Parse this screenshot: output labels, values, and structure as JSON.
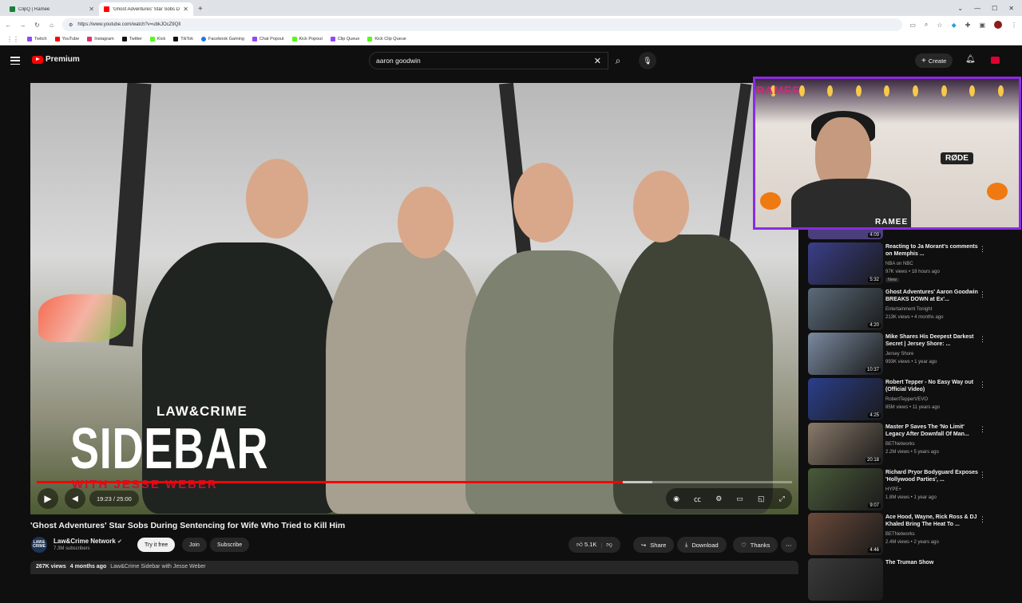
{
  "browser": {
    "tabs": [
      {
        "title": "ClipQ | Ramee",
        "active": false,
        "color": "#1a7f37"
      },
      {
        "title": "'Ghost Adventures' Star Sobs D",
        "active": true,
        "color": "#ff0000"
      }
    ],
    "url": "https://www.youtube.com/watch?v=ubkJOcZ9QIl",
    "bookmarks": [
      {
        "label": "Twitch",
        "color": "#9146ff"
      },
      {
        "label": "YouTube",
        "color": "#ff0000"
      },
      {
        "label": "Instagram",
        "color": "#e1306c"
      },
      {
        "label": "Twitter",
        "color": "#111111"
      },
      {
        "label": "Kick",
        "color": "#53fc18"
      },
      {
        "label": "TikTok",
        "color": "#111111"
      },
      {
        "label": "Facebook Gaming",
        "color": "#1877f2"
      },
      {
        "label": "Chat Popout",
        "color": "#9146ff"
      },
      {
        "label": "Kick Popout",
        "color": "#53fc18"
      },
      {
        "label": "Clip Queue",
        "color": "#9146ff"
      },
      {
        "label": "Kick Clip Queue",
        "color": "#53fc18"
      }
    ]
  },
  "youtube": {
    "logo_label": "Premium",
    "search_query": "aaron goodwin",
    "create_label": "Create"
  },
  "player": {
    "logo_small": "LAW&CRIME",
    "logo_big": "SIDEBAR",
    "logo_sub": "WITH JESSE WEBER",
    "time": "19:23 / 25:00",
    "progress_fraction": 0.776,
    "buffer_fraction": 0.815
  },
  "webcam": {
    "overlay_name": "RAMEE",
    "brand": "RAMEE",
    "mic_brand": "RØDE"
  },
  "video": {
    "title": "'Ghost Adventures' Star Sobs During Sentencing for Wife Who Tried to Kill Him",
    "channel_name": "Law&Crime Network",
    "channel_avatar": "LAW&\nCRIME",
    "subscribers": "7.3M subscribers",
    "try_label": "Try it free",
    "join_label": "Join",
    "subscribe_label": "Subscribe",
    "likes": "5.1K",
    "share_label": "Share",
    "download_label": "Download",
    "thanks_label": "Thanks",
    "views": "267K views",
    "age": "4 months ago",
    "description_start": "Law&Crime Sidebar with Jesse Weber"
  },
  "recommendations": [
    {
      "title": "Reacting to Ja Morant's comments on Memphis ...",
      "channel": "NBA on NBC",
      "meta": "97K views • 18 hours ago",
      "duration": "5:32",
      "badge": "New",
      "color": "#3a3f8a"
    },
    {
      "title": "Ghost Adventures' Aaron Goodwin BREAKS DOWN at Ex'...",
      "channel": "Entertainment Tonight",
      "meta": "213K views • 4 months ago",
      "duration": "4:20",
      "badge": "",
      "color": "#5b6b7a"
    },
    {
      "title": "Mike Shares His Deepest Darkest Secret | Jersey Shore: ...",
      "channel": "Jersey Shore",
      "meta": "993K views • 1 year ago",
      "duration": "10:37",
      "badge": "",
      "color": "#7a8aa0"
    },
    {
      "title": "Robert Tepper - No Easy Way out (Official Video)",
      "channel": "RobertTepperVEVO",
      "meta": "85M views • 11 years ago",
      "duration": "4:25",
      "badge": "",
      "color": "#2b3f8c"
    },
    {
      "title": "Master P Saves The 'No Limit' Legacy After Downfall Of Man...",
      "channel": "BETNetworks",
      "meta": "2.2M views • 5 years ago",
      "duration": "20:18",
      "badge": "",
      "color": "#8a7a6a"
    },
    {
      "title": "Richard Pryor Bodyguard Exposes 'Hollywood Parties', ...",
      "channel": "HYPE+",
      "meta": "1.8M views • 1 year ago",
      "duration": "9:07",
      "badge": "",
      "color": "#4a5a3a"
    },
    {
      "title": "Ace Hood, Wayne, Rick Ross & DJ Khaled Bring The Heat To ...",
      "channel": "BETNetworks",
      "meta": "2.4M views • 2 years ago",
      "duration": "4:46",
      "badge": "",
      "color": "#6a4a3a"
    },
    {
      "title": "The Truman Show",
      "channel": "",
      "meta": "",
      "duration": "",
      "badge": "",
      "color": "#3a3a3a"
    }
  ],
  "first_rec_duration": "4:09"
}
